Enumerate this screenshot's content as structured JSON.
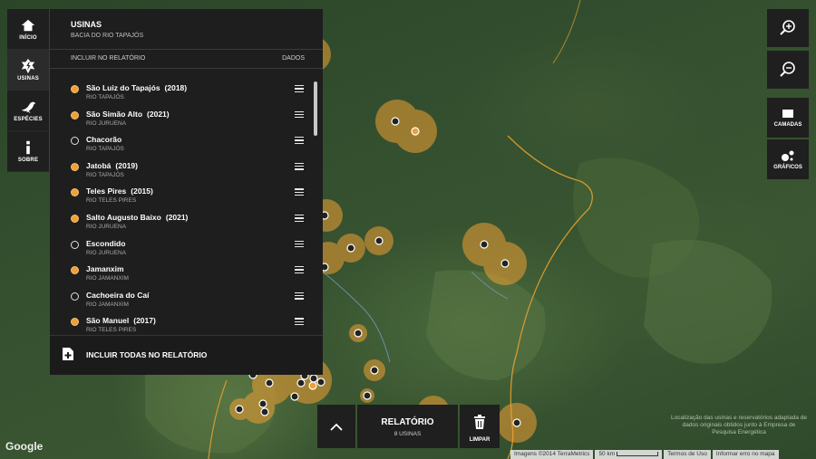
{
  "nav": [
    {
      "label": "INÍCIO",
      "icon": "home-icon"
    },
    {
      "label": "USINAS",
      "icon": "power-plant-icon"
    },
    {
      "label": "ESPÉCIES",
      "icon": "bird-icon"
    },
    {
      "label": "SOBRE",
      "icon": "info-icon"
    }
  ],
  "panel": {
    "title": "USINAS",
    "subtitle": "BACIA DO RIO TAPAJÓS",
    "col_include": "INCLUIR NO RELATÓRIO",
    "col_data": "DADOS",
    "include_all": "INCLUIR TODAS NO RELATÓRIO"
  },
  "plants": [
    {
      "name": "São Luiz do Tapajós",
      "year": "(2018)",
      "river": "RIO TAPAJÓS",
      "selected": true
    },
    {
      "name": "São Simão Alto",
      "year": "(2021)",
      "river": "RIO JURUENA",
      "selected": true
    },
    {
      "name": "Chacorão",
      "year": "",
      "river": "RIO TAPAJÓS",
      "selected": false
    },
    {
      "name": "Jatobá",
      "year": "(2019)",
      "river": "RIO TAPAJÓS",
      "selected": true
    },
    {
      "name": "Teles Pires",
      "year": "(2015)",
      "river": "RIO TELES PIRES",
      "selected": true
    },
    {
      "name": "Salto Augusto Baixo",
      "year": "(2021)",
      "river": "RIO JURUENA",
      "selected": true
    },
    {
      "name": "Escondido",
      "year": "",
      "river": "RIO JURUENA",
      "selected": false
    },
    {
      "name": "Jamanxim",
      "year": "",
      "river": "RIO JAMANXIM",
      "selected": true
    },
    {
      "name": "Cachoeira do Caí",
      "year": "",
      "river": "RIO JAMANXIM",
      "selected": false
    },
    {
      "name": "São Manuel",
      "year": "(2017)",
      "river": "RIO TELES PIRES",
      "selected": true
    }
  ],
  "controls": {
    "layers": "CAMADAS",
    "charts": "GRÁFICOS"
  },
  "report": {
    "title": "RELATÓRIO",
    "count": "8 USINAS",
    "clear": "LIMPAR"
  },
  "credit": "Localização das usinas e reservatórios adaptada de dados originais obtidos junto à Empresa de Pesquisa Energética",
  "map_footer": {
    "imagery": "Imagens ©2014 TerraMetrics",
    "scale": "50 km",
    "terms": "Termos de Uso",
    "report_error": "Informar erro no mapa"
  },
  "google": "Google",
  "colors": {
    "accent": "#f0a033",
    "panel": "#1e1e1e",
    "river_boundary": "#e0a030"
  }
}
